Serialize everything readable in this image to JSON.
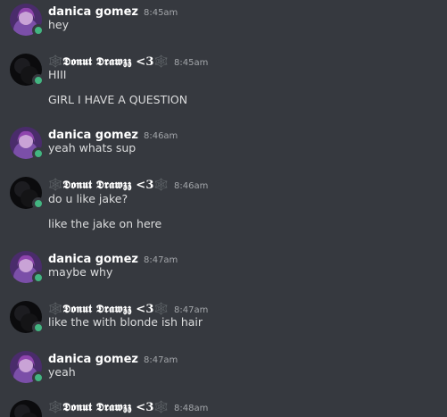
{
  "colors": {
    "background": "#36393f",
    "username": "#ffffff",
    "message_text": "#dcddde",
    "timestamp": "#a3a6aa",
    "online": "#43b581"
  },
  "users": {
    "danica": {
      "name": "danica gomez",
      "avatar_icon": "purple-haired-avatar-icon"
    },
    "donut": {
      "name": "🕸️𝕯𝖔𝖓𝖚𝖙 𝕯𝖗𝖆𝖜𝖟𝖟 <3🕸️",
      "avatar_icon": "dark-avatar-icon"
    }
  },
  "messages": [
    {
      "author": "danica gomez",
      "time": "8:45am",
      "lines": [
        "hey"
      ]
    },
    {
      "author": "🕸️𝕯𝖔𝖓𝖚𝖙 𝕯𝖗𝖆𝖜𝖟𝖟 <3🕸️",
      "time": "8:45am",
      "lines": [
        "HIII",
        "GIRL I HAVE A QUESTION"
      ]
    },
    {
      "author": "danica gomez",
      "time": "8:46am",
      "lines": [
        "yeah whats sup"
      ]
    },
    {
      "author": "🕸️𝕯𝖔𝖓𝖚𝖙 𝕯𝖗𝖆𝖜𝖟𝖟 <3🕸️",
      "time": "8:46am",
      "lines": [
        "do u like jake?",
        "like the jake on here"
      ]
    },
    {
      "author": "danica gomez",
      "time": "8:47am",
      "lines": [
        "maybe why"
      ]
    },
    {
      "author": "🕸️𝕯𝖔𝖓𝖚𝖙 𝕯𝖗𝖆𝖜𝖟𝖟 <3🕸️",
      "time": "8:47am",
      "lines": [
        "like the with blonde ish hair"
      ]
    },
    {
      "author": "danica gomez",
      "time": "8:47am",
      "lines": [
        "yeah"
      ]
    },
    {
      "author": "🕸️𝕯𝖔𝖓𝖚𝖙 𝕯𝖗𝖆𝖜𝖟𝖟 <3🕸️",
      "time": "8:48am",
      "lines": []
    }
  ]
}
